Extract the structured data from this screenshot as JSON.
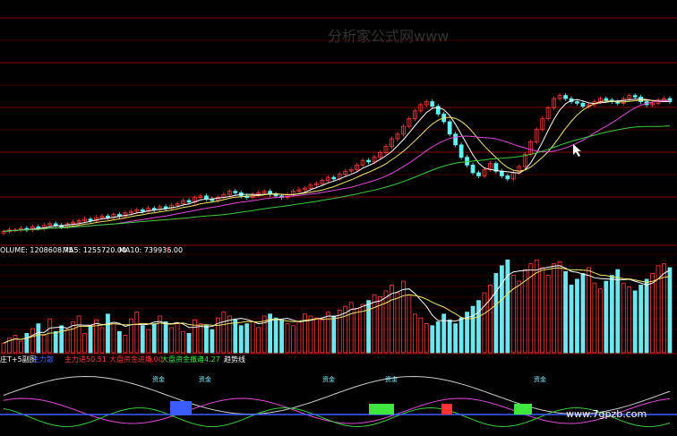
{
  "colors": {
    "background": "#000000",
    "grid": "#8b0000",
    "up_candle": "#ff3b3b",
    "down_candle": "#5ff4f4",
    "ma_a": "#ffffff",
    "ma_b": "#f2e66b",
    "ma_c": "#e04bdc",
    "ma_d": "#3ccc3c",
    "volume_up": "#ff4040",
    "volume_down": "#6fe6ee",
    "label_green": "#3ee63e",
    "label_red": "#ff3333",
    "label_blue": "#3a5cff",
    "label_cyan": "#7ff0ff"
  },
  "volume_labels": {
    "volume": "OLUME: 1208608.75",
    "ma5": "MA5: 1255720.00",
    "ma10": "MA10: 739936.00"
  },
  "indicator_labels": {
    "name": "庄T+5副图",
    "l1": "主力散",
    "l2": "主力进",
    "l3": "50.51",
    "l4": "大盘资金进场",
    "l5": "0.00",
    "l6": "大盘资金撤走",
    "l7": "-44.27",
    "l8": "趋势线"
  },
  "annotation": {
    "text": "资金",
    "show_count": 5
  },
  "watermark_top": "分析家公式网www",
  "watermark_bottom": "www.7gpzb.com",
  "chart_data": [
    {
      "type": "candlestick",
      "series": [
        {
          "name": "price",
          "values": [
            2,
            3,
            3,
            4,
            3,
            5,
            4,
            6,
            7,
            6,
            5,
            7,
            8,
            9,
            10,
            9,
            11,
            12,
            11,
            13,
            12,
            14,
            15,
            16,
            15,
            17,
            16,
            18,
            17,
            19,
            20,
            22,
            21,
            24,
            25,
            23,
            22,
            24,
            26,
            28,
            27,
            25,
            24,
            26,
            27,
            28,
            26,
            25,
            24,
            26,
            28,
            29,
            30,
            32,
            33,
            35,
            37,
            36,
            39,
            41,
            42,
            45,
            48,
            47,
            50,
            53,
            57,
            62,
            65,
            70,
            75,
            80,
            84,
            86,
            83,
            78,
            73,
            65,
            58,
            50,
            45,
            40,
            38,
            42,
            46,
            41,
            38,
            36,
            40,
            44,
            52,
            60,
            68,
            75,
            82,
            88,
            90,
            88,
            86,
            85,
            83,
            84,
            86,
            88,
            87,
            86,
            85,
            88,
            90,
            89,
            86,
            84,
            85,
            87,
            88,
            86
          ]
        }
      ]
    },
    {
      "type": "bar",
      "series": [
        {
          "name": "volume",
          "values": [
            10,
            15,
            18,
            12,
            20,
            25,
            30,
            18,
            35,
            22,
            28,
            24,
            32,
            38,
            20,
            28,
            34,
            26,
            40,
            30,
            22,
            18,
            35,
            42,
            28,
            24,
            30,
            38,
            32,
            26,
            30,
            22,
            20,
            34,
            30,
            28,
            24,
            36,
            42,
            38,
            34,
            28,
            30,
            32,
            26,
            38,
            40,
            36,
            34,
            30,
            28,
            32,
            40,
            38,
            36,
            34,
            42,
            38,
            44,
            48,
            52,
            46,
            50,
            54,
            60,
            58,
            64,
            70,
            62,
            74,
            60,
            40,
            36,
            30,
            28,
            32,
            40,
            34,
            30,
            36,
            42,
            48,
            54,
            62,
            70,
            82,
            90,
            96,
            80,
            74,
            86,
            92,
            96,
            88,
            80,
            92,
            94,
            84,
            70,
            76,
            82,
            88,
            72,
            66,
            74,
            80,
            86,
            72,
            68,
            64,
            70,
            76,
            82,
            90,
            92,
            88
          ]
        }
      ]
    }
  ]
}
